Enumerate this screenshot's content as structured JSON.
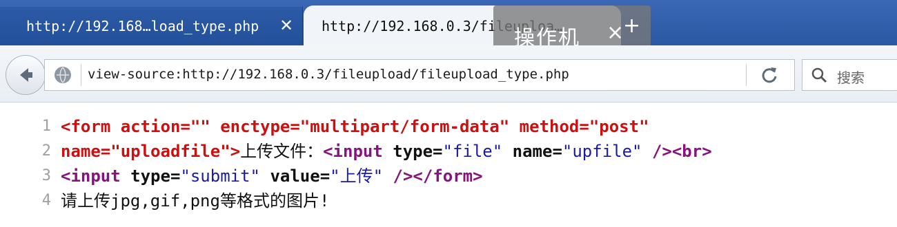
{
  "tabs": [
    {
      "title": "http://192.168…load_type.php",
      "close": "✕",
      "active": false
    },
    {
      "title": "http://192.168.0.3/fileuploa…",
      "active": true
    }
  ],
  "overlay": {
    "label": "操作机",
    "x": "×",
    "plus": "+"
  },
  "navbar": {
    "url": "view-source:http://192.168.0.3/fileupload/fileupload_type.php",
    "search_placeholder": "搜索"
  },
  "source_lines": [
    {
      "n": "1"
    },
    {
      "n": "2"
    },
    {
      "n": "3"
    },
    {
      "n": "4"
    }
  ],
  "source": {
    "l1": {
      "open": "<form",
      "action_attr": " action=",
      "action_val": "\"\"",
      "enctype_attr": " enctype=",
      "enctype_val": "\"multipart/form-data\"",
      "method_attr": " method=",
      "method_val": "\"post\""
    },
    "l2": {
      "name_attr": "name=",
      "name_val": "\"uploadfile\"",
      "close": ">",
      "text": "上传文件：",
      "input_open": "<input",
      "type_attr": " type=",
      "type_val": "\"file\"",
      "name2_attr": " name=",
      "name2_val": "\"upfile\"",
      "self_close": " />",
      "br": "<br>"
    },
    "l3": {
      "input_open": "<input",
      "type_attr": " type=",
      "type_val": "\"submit\"",
      "value_attr": " value=",
      "value_val": "\"上传\"",
      "self_close": " />",
      "form_close": "</form>"
    },
    "l4": {
      "text": "请上传jpg,gif,png等格式的图片!"
    }
  },
  "colors": {
    "tag": "#881280",
    "error_tag": "#cc1010",
    "attr_value": "#1a1aa6",
    "tabstrip": "#2b58a3"
  },
  "icons": [
    "back-arrow-icon",
    "globe-icon",
    "reload-icon",
    "search-icon",
    "close-icon"
  ]
}
